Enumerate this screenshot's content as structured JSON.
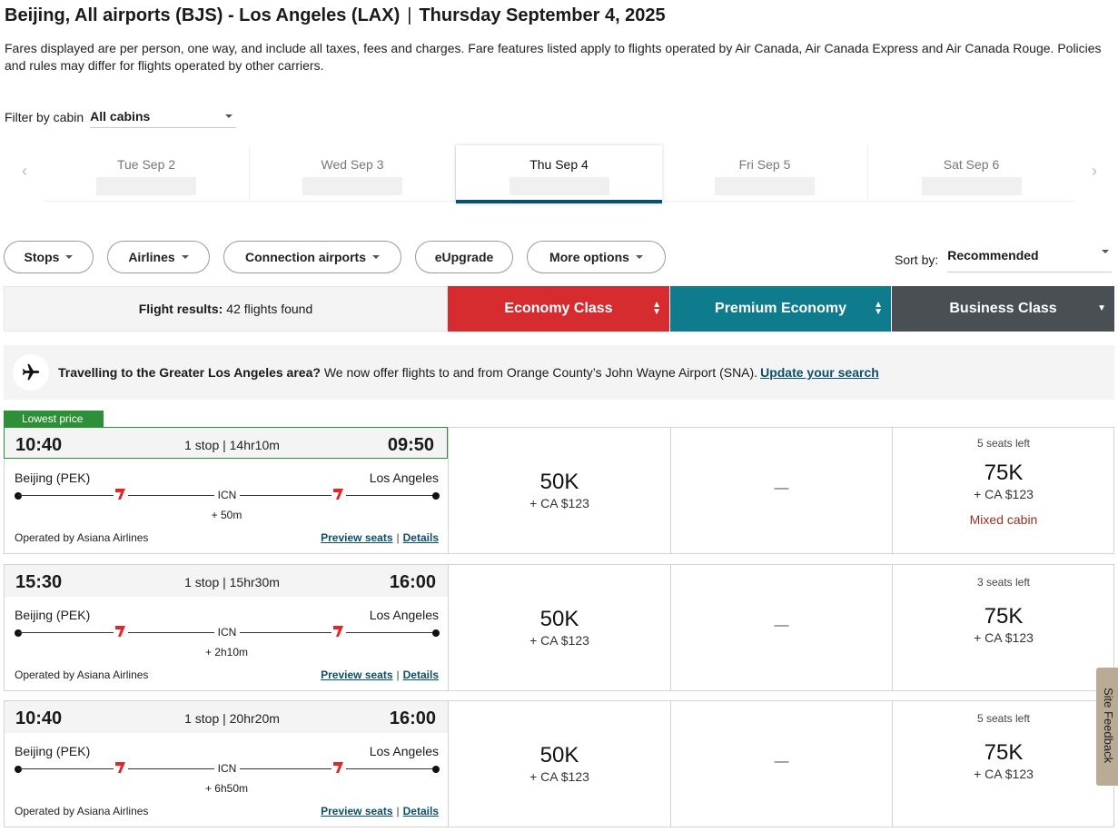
{
  "header": {
    "route": "Beijing, All airports (BJS) - Los Angeles (LAX)",
    "separator": "|",
    "date": "Thursday September 4, 2025",
    "disclaimer": "Fares displayed are per person, one way, and include all taxes, fees and charges. Fare features listed apply to flights operated by Air Canada, Air Canada Express and Air Canada Rouge. Policies and rules may differ for flights operated by other carriers."
  },
  "filter": {
    "label": "Filter by cabin",
    "value": "All cabins"
  },
  "dates": [
    {
      "label": "Tue Sep 2",
      "active": false
    },
    {
      "label": "Wed Sep 3",
      "active": false
    },
    {
      "label": "Thu Sep 4",
      "active": true
    },
    {
      "label": "Fri Sep 5",
      "active": false
    },
    {
      "label": "Sat Sep 6",
      "active": false
    }
  ],
  "pills": {
    "stops": "Stops",
    "airlines": "Airlines",
    "connection": "Connection airports",
    "eupgrade": "eUpgrade",
    "more": "More options"
  },
  "sort": {
    "label": "Sort by:",
    "value": "Recommended"
  },
  "results": {
    "label": "Flight results:",
    "count": "42 flights found"
  },
  "cabins": {
    "economy": {
      "label": "Economy Class",
      "color": "#d62b2f"
    },
    "premium": {
      "label": "Premium Economy",
      "color": "#0e7c8c"
    },
    "business": {
      "label": "Business Class",
      "color": "#4a4f54"
    }
  },
  "notice": {
    "bold": "Travelling to the Greater Los Angeles area?",
    "text": "We now offer flights to and from Orange County’s John Wayne Airport (SNA).",
    "link": "Update your search"
  },
  "badge": "Lowest price",
  "flights": [
    {
      "depart": "10:40",
      "arrive": "09:50",
      "summary": "1 stop | 14hr10m",
      "from": "Beijing (PEK)",
      "to": "Los Angeles",
      "connection": "ICN",
      "layover": "+ 50m",
      "operated": "Operated by Asiana Airlines",
      "preview": "Preview seats",
      "details": "Details",
      "economy": {
        "points": "50K",
        "tax": "+ CA $123"
      },
      "premium": "—",
      "business": {
        "seats": "5 seats left",
        "points": "75K",
        "tax": "+ CA $123",
        "note": "Mixed cabin"
      }
    },
    {
      "depart": "15:30",
      "arrive": "16:00",
      "summary": "1 stop | 15hr30m",
      "from": "Beijing (PEK)",
      "to": "Los Angeles",
      "connection": "ICN",
      "layover": "+ 2h10m",
      "operated": "Operated by Asiana Airlines",
      "preview": "Preview seats",
      "details": "Details",
      "economy": {
        "points": "50K",
        "tax": "+ CA $123"
      },
      "premium": "—",
      "business": {
        "seats": "3 seats left",
        "points": "75K",
        "tax": "+ CA $123"
      }
    },
    {
      "depart": "10:40",
      "arrive": "16:00",
      "summary": "1 stop | 20hr20m",
      "from": "Beijing (PEK)",
      "to": "Los Angeles",
      "connection": "ICN",
      "layover": "+ 6h50m",
      "operated": "Operated by Asiana Airlines",
      "preview": "Preview seats",
      "details": "Details",
      "economy": {
        "points": "50K",
        "tax": "+ CA $123"
      },
      "premium": "—",
      "business": {
        "seats": "5 seats left",
        "points": "75K",
        "tax": "+ CA $123"
      }
    }
  ],
  "feedback": "Site Feedback",
  "icons": {
    "prev": "chevron-left-icon",
    "next": "chevron-right-icon",
    "plane": "airplane-icon",
    "airline": "asiana-tail-icon"
  }
}
